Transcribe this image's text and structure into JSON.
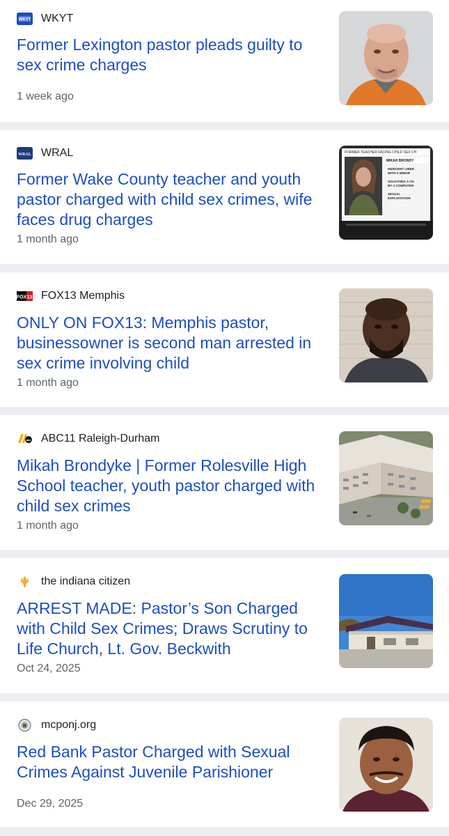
{
  "articles": [
    {
      "source": "WKYT",
      "logo_text": "WKYT",
      "headline": "Former Lexington pastor pleads guilty to sex crime charges",
      "time": "1 week ago",
      "thumb_icon": "mugshot-photo"
    },
    {
      "source": "WRAL",
      "logo_text": "WRAL",
      "headline": "Former Wake County teacher and youth pastor charged with child sex crimes, wife faces drug charges",
      "time": "1 month ago",
      "thumb_icon": "news-screenshot-photo",
      "thumb_text": {
        "banner": "FORMER TEACHER FACING CHILD SEX CH",
        "name": "MIKAH BRONDY",
        "b1": "INDECENT LIBER",
        "b1b": "WITH A MINOR",
        "b2": "SOLICITING A CH",
        "b2b": "BY A COMPUTER",
        "b3": "SEXUAL",
        "b3b": "EXPLOITATION"
      }
    },
    {
      "source": "FOX13 Memphis",
      "logo_text": "FOX 13",
      "headline": "ONLY ON FOX13: Memphis pastor, businessowner is second man arrested in sex crime involving child",
      "time": "1 month ago",
      "thumb_icon": "mugshot-photo"
    },
    {
      "source": "ABC11 Raleigh-Durham",
      "logo_text": "abc",
      "headline": "Mikah Brondyke | Former Rolesville High School teacher, youth pastor charged with child sex crimes",
      "time": "1 month ago",
      "thumb_icon": "aerial-school-photo"
    },
    {
      "source": "the indiana citizen",
      "logo_text": "",
      "headline": "ARREST MADE: Pastor’s Son Charged with Child Sex Crimes; Draws Scrutiny to Life Church, Lt. Gov. Beckwith",
      "time": "Oct 24, 2025",
      "thumb_icon": "church-building-photo"
    },
    {
      "source": "mcponj.org",
      "logo_text": "",
      "headline": "Red Bank Pastor Charged with Sexual Crimes Against Juvenile Parishioner",
      "time": "Dec 29, 2025",
      "thumb_icon": "portrait-photo"
    }
  ],
  "colors": {
    "headline": "#1a4fc4",
    "source": "#202124",
    "time": "#5f6368",
    "separator": "#eceef1"
  }
}
